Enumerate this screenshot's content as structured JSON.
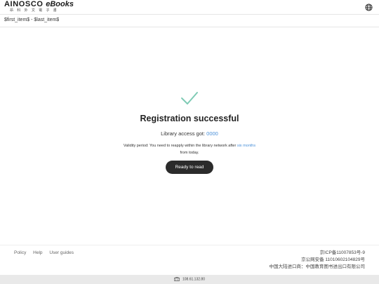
{
  "header": {
    "logo_main": "AINOSCO",
    "logo_ebooks": "eBooks",
    "logo_sub": "昂科外文電子書",
    "globe_icon": "globe-icon"
  },
  "breadcrumb": {
    "text": "$first_item$ - $last_item$"
  },
  "result": {
    "check_icon": "checkmark-icon",
    "check_color": "#7fcbb5",
    "title": "Registration successful",
    "access_label": "Library access got:",
    "access_value": "0000",
    "validity_prefix": "Validity period: You need to reapply within the library network after",
    "validity_highlight": "six months",
    "validity_suffix": "from today.",
    "button_label": "Ready to read",
    "accent_color": "#4a90d9"
  },
  "footer": {
    "links": [
      "Policy",
      "Help",
      "User guides"
    ],
    "icp": "京ICP备11007853号-9",
    "security": "京公网安备 11010602104829号",
    "importer": "中国大陆进口商：中国教育图书进出口有限公司"
  },
  "status_bar": {
    "ip_icon": "building-icon",
    "ip": "108.61.132.80"
  }
}
